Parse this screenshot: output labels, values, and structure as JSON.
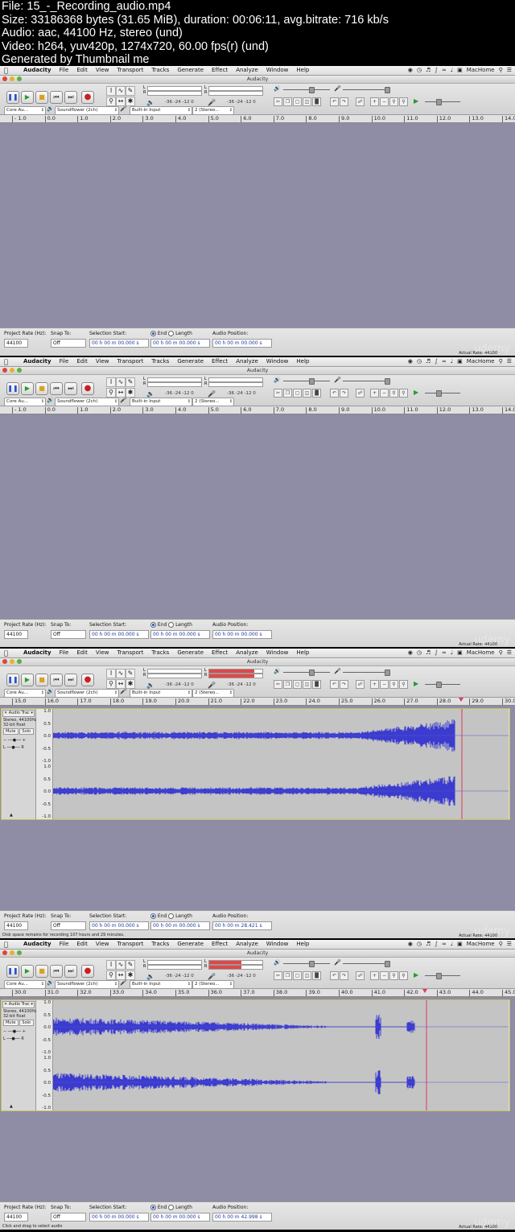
{
  "header": {
    "lines": [
      "File: 15_-_Recording_audio.mp4",
      "Size: 33186368 bytes (31.65 MiB), duration: 00:06:11, avg.bitrate: 716 kb/s",
      "Audio: aac, 44100 Hz, stereo (und)",
      "Video: h264, yuv420p, 1274x720, 60.00 fps(r) (und)",
      "Generated by Thumbnail me"
    ]
  },
  "menubar": {
    "items": [
      "Audacity",
      "File",
      "Edit",
      "View",
      "Transport",
      "Tracks",
      "Generate",
      "Effect",
      "Analyze",
      "Window",
      "Help"
    ],
    "right_user": "MacHome"
  },
  "window_title": "Audacity",
  "toolbar": {
    "meter_scale_left": "-36  -24  -12  0",
    "meter_scale_right": "-36  -24  -12  0",
    "host": "Core Au...",
    "output_device": "Soundflower (2ch)",
    "input_device": "Built-in Input",
    "channels": "2 (Stereo..."
  },
  "statusbar": {
    "project_rate_label": "Project Rate (Hz):",
    "project_rate": "44100",
    "snap_label": "Snap To:",
    "snap_value": "Off",
    "selection_start_label": "Selection Start:",
    "end_label": "End",
    "length_label": "Length",
    "audio_position_label": "Audio Position:",
    "actual_rate_label": "Actual Rate:",
    "actual_rate": "44100",
    "watermark": "udemy"
  },
  "track": {
    "name": "Audio Trac",
    "format1": "Stereo, 44100Hz",
    "format2": "32-bit float",
    "mute": "Mute",
    "solo": "Solo",
    "scale": [
      "1.0",
      "0.5",
      "0.0",
      "-0.5",
      "-1.0"
    ]
  },
  "frames": [
    {
      "ticks": [
        "- 1.0",
        "0.0",
        "1.0",
        "2.0",
        "3.0",
        "4.0",
        "5.0",
        "6.0",
        "7.0",
        "8.0",
        "9.0",
        "10.0",
        "11.0",
        "12.0",
        "13.0",
        "14.0"
      ],
      "has_track": false,
      "selection_start": "00 h 00 m 00.000 s",
      "selection_end": "00 h 00 m 00.000 s",
      "audio_position": "00 h 00 m 00.000 s",
      "disk_note": "",
      "meter_level": 0
    },
    {
      "ticks": [
        "- 1.0",
        "0.0",
        "1.0",
        "2.0",
        "3.0",
        "4.0",
        "5.0",
        "6.0",
        "7.0",
        "8.0",
        "9.0",
        "10.0",
        "11.0",
        "12.0",
        "13.0",
        "14.0"
      ],
      "has_track": false,
      "selection_start": "00 h 00 m 00.000 s",
      "selection_end": "00 h 00 m 00.000 s",
      "audio_position": "00 h 00 m 00.000 s",
      "disk_note": "",
      "meter_level": 0
    },
    {
      "ticks": [
        "15.0",
        "16.0",
        "17.0",
        "18.0",
        "19.0",
        "20.0",
        "21.0",
        "22.0",
        "23.0",
        "24.0",
        "25.0",
        "26.0",
        "27.0",
        "28.0",
        "29.0",
        "30.0"
      ],
      "has_track": true,
      "selection_start": "00 h 00 m 00.000 s",
      "selection_end": "00 h 00 m 00.000 s",
      "audio_position": "00 h 00 m 28.421 s",
      "disk_note": "Disk space remains for recording 107 hours and 29 minutes.",
      "meter_level": 0.85
    },
    {
      "ticks": [
        "30.0",
        "31.0",
        "32.0",
        "33.0",
        "34.0",
        "35.0",
        "36.0",
        "37.0",
        "38.0",
        "39.0",
        "40.0",
        "41.0",
        "42.0",
        "43.0",
        "44.0",
        "45.0"
      ],
      "has_track": true,
      "selection_start": "00 h 00 m 00.000 s",
      "selection_end": "00 h 00 m 00.000 s",
      "audio_position": "00 h 00 m 42.998 s",
      "disk_note": "Click and drag to select audio",
      "meter_level": 0.6
    }
  ]
}
